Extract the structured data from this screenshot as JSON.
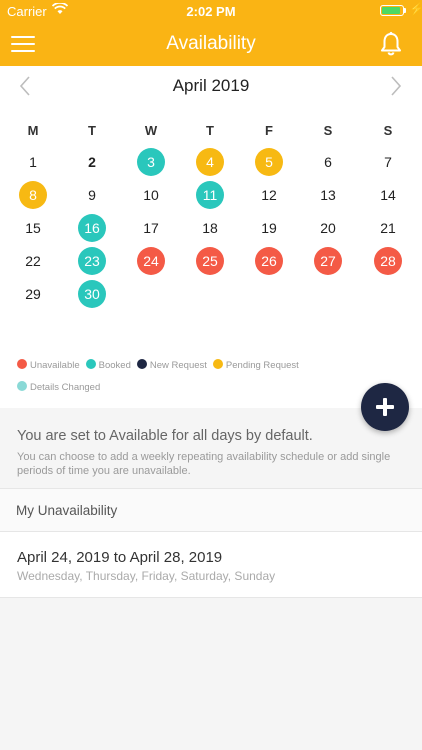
{
  "status_bar": {
    "carrier": "Carrier",
    "time": "2:02 PM",
    "battery_level": 0.9,
    "battery_color": "#4cd964"
  },
  "nav": {
    "title": "Availability"
  },
  "calendar": {
    "month_title": "April 2019",
    "weekdays": [
      "M",
      "T",
      "W",
      "T",
      "F",
      "S",
      "S"
    ],
    "first_weekday_index": 0,
    "days_in_month": 30,
    "today": 2,
    "status_colors": {
      "unavailable": "#f45a46",
      "booked": "#2ac7bc",
      "new_request": "#1e2743",
      "pending": "#f7b913",
      "details_changed": "#8ad9d6"
    },
    "marked_days": {
      "3": "booked",
      "4": "pending",
      "5": "pending",
      "8": "pending",
      "11": "booked",
      "16": "booked",
      "23": "booked",
      "30": "booked",
      "24": "unavailable",
      "25": "unavailable",
      "26": "unavailable",
      "27": "unavailable",
      "28": "unavailable"
    }
  },
  "legend": [
    {
      "label": "Unavailable",
      "status": "unavailable"
    },
    {
      "label": "Booked",
      "status": "booked"
    },
    {
      "label": "New Request",
      "status": "new_request"
    },
    {
      "label": "Pending Request",
      "status": "pending"
    },
    {
      "label": "Details Changed",
      "status": "details_changed"
    }
  ],
  "info": {
    "title": "You are set to Available for all days by default.",
    "subtitle": "You can choose to add a weekly repeating availability schedule or add single periods of time you are unavailable."
  },
  "section": {
    "header": "My Unavailability"
  },
  "unavailability": [
    {
      "range": "April 24, 2019 to April 28, 2019",
      "days": "Wednesday, Thursday, Friday, Saturday, Sunday"
    }
  ]
}
